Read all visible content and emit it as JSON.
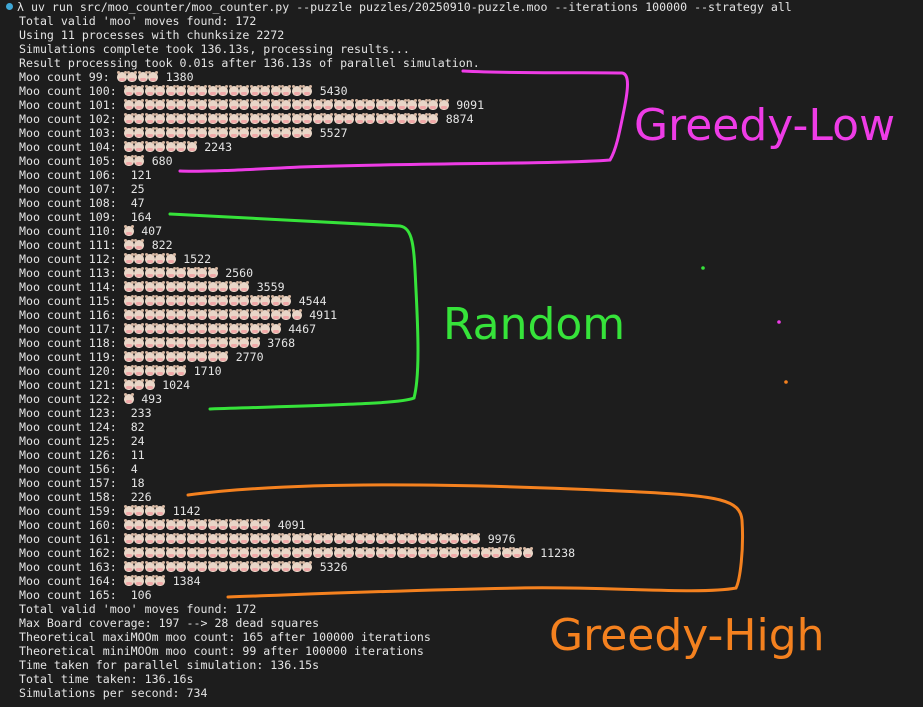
{
  "command": "λ uv run src/moo_counter/moo_counter.py --puzzle puzzles/20250910-puzzle.moo --iterations 100000 --strategy all",
  "header_lines": [
    "Total valid 'moo' moves found: 172",
    "Using 11 processes with chunksize 2272",
    "Simulations complete took 136.13s, processing results...",
    "Result processing took 0.01s after 136.13s of parallel simulation."
  ],
  "moo_rows": [
    {
      "label": "Moo count 99:",
      "icons": 4,
      "count": "1380"
    },
    {
      "label": "Moo count 100:",
      "icons": 18,
      "count": "5430"
    },
    {
      "label": "Moo count 101:",
      "icons": 31,
      "count": "9091"
    },
    {
      "label": "Moo count 102:",
      "icons": 30,
      "count": "8874"
    },
    {
      "label": "Moo count 103:",
      "icons": 18,
      "count": "5527"
    },
    {
      "label": "Moo count 104:",
      "icons": 7,
      "count": "2243"
    },
    {
      "label": "Moo count 105:",
      "icons": 2,
      "count": "680"
    },
    {
      "label": "Moo count 106:",
      "icons": 0,
      "count": "121"
    },
    {
      "label": "Moo count 107:",
      "icons": 0,
      "count": "25"
    },
    {
      "label": "Moo count 108:",
      "icons": 0,
      "count": "47"
    },
    {
      "label": "Moo count 109:",
      "icons": 0,
      "count": "164"
    },
    {
      "label": "Moo count 110:",
      "icons": 1,
      "count": "407"
    },
    {
      "label": "Moo count 111:",
      "icons": 2,
      "count": "822"
    },
    {
      "label": "Moo count 112:",
      "icons": 5,
      "count": "1522"
    },
    {
      "label": "Moo count 113:",
      "icons": 9,
      "count": "2560"
    },
    {
      "label": "Moo count 114:",
      "icons": 12,
      "count": "3559"
    },
    {
      "label": "Moo count 115:",
      "icons": 16,
      "count": "4544"
    },
    {
      "label": "Moo count 116:",
      "icons": 17,
      "count": "4911"
    },
    {
      "label": "Moo count 117:",
      "icons": 15,
      "count": "4467"
    },
    {
      "label": "Moo count 118:",
      "icons": 13,
      "count": "3768"
    },
    {
      "label": "Moo count 119:",
      "icons": 10,
      "count": "2770"
    },
    {
      "label": "Moo count 120:",
      "icons": 6,
      "count": "1710"
    },
    {
      "label": "Moo count 121:",
      "icons": 3,
      "count": "1024"
    },
    {
      "label": "Moo count 122:",
      "icons": 1,
      "count": "493"
    },
    {
      "label": "Moo count 123:",
      "icons": 0,
      "count": "233"
    },
    {
      "label": "Moo count 124:",
      "icons": 0,
      "count": "82"
    },
    {
      "label": "Moo count 125:",
      "icons": 0,
      "count": "24"
    },
    {
      "label": "Moo count 126:",
      "icons": 0,
      "count": "11"
    },
    {
      "label": "Moo count 156:",
      "icons": 0,
      "count": "4"
    },
    {
      "label": "Moo count 157:",
      "icons": 0,
      "count": "18"
    },
    {
      "label": "Moo count 158:",
      "icons": 0,
      "count": "226"
    },
    {
      "label": "Moo count 159:",
      "icons": 4,
      "count": "1142"
    },
    {
      "label": "Moo count 160:",
      "icons": 14,
      "count": "4091"
    },
    {
      "label": "Moo count 161:",
      "icons": 34,
      "count": "9976"
    },
    {
      "label": "Moo count 162:",
      "icons": 39,
      "count": "11238"
    },
    {
      "label": "Moo count 163:",
      "icons": 18,
      "count": "5326"
    },
    {
      "label": "Moo count 164:",
      "icons": 4,
      "count": "1384"
    },
    {
      "label": "Moo count 165:",
      "icons": 0,
      "count": "106"
    }
  ],
  "footer_lines": [
    "Total valid 'moo' moves found: 172",
    "Max Board coverage: 197 --> 28 dead squares",
    "Theoretical maxiMOOm moo count: 165 after 100000 iterations",
    "Theoretical miniMOOm moo count: 99 after 100000 iterations",
    "Time taken for parallel simulation: 136.15s",
    "Total time taken: 136.16s",
    "Simulations per second: 734"
  ],
  "annotations": {
    "greedy_low": {
      "text": "Greedy-Low",
      "color": "#ee3ce6"
    },
    "random": {
      "text": "Random",
      "color": "#36e33a"
    },
    "greedy_high": {
      "text": "Greedy-High",
      "color": "#f4811f"
    }
  },
  "icon_name": "cow-face-icon",
  "colors": {
    "background": "#1d1d1d",
    "text": "#e4e4e4"
  }
}
